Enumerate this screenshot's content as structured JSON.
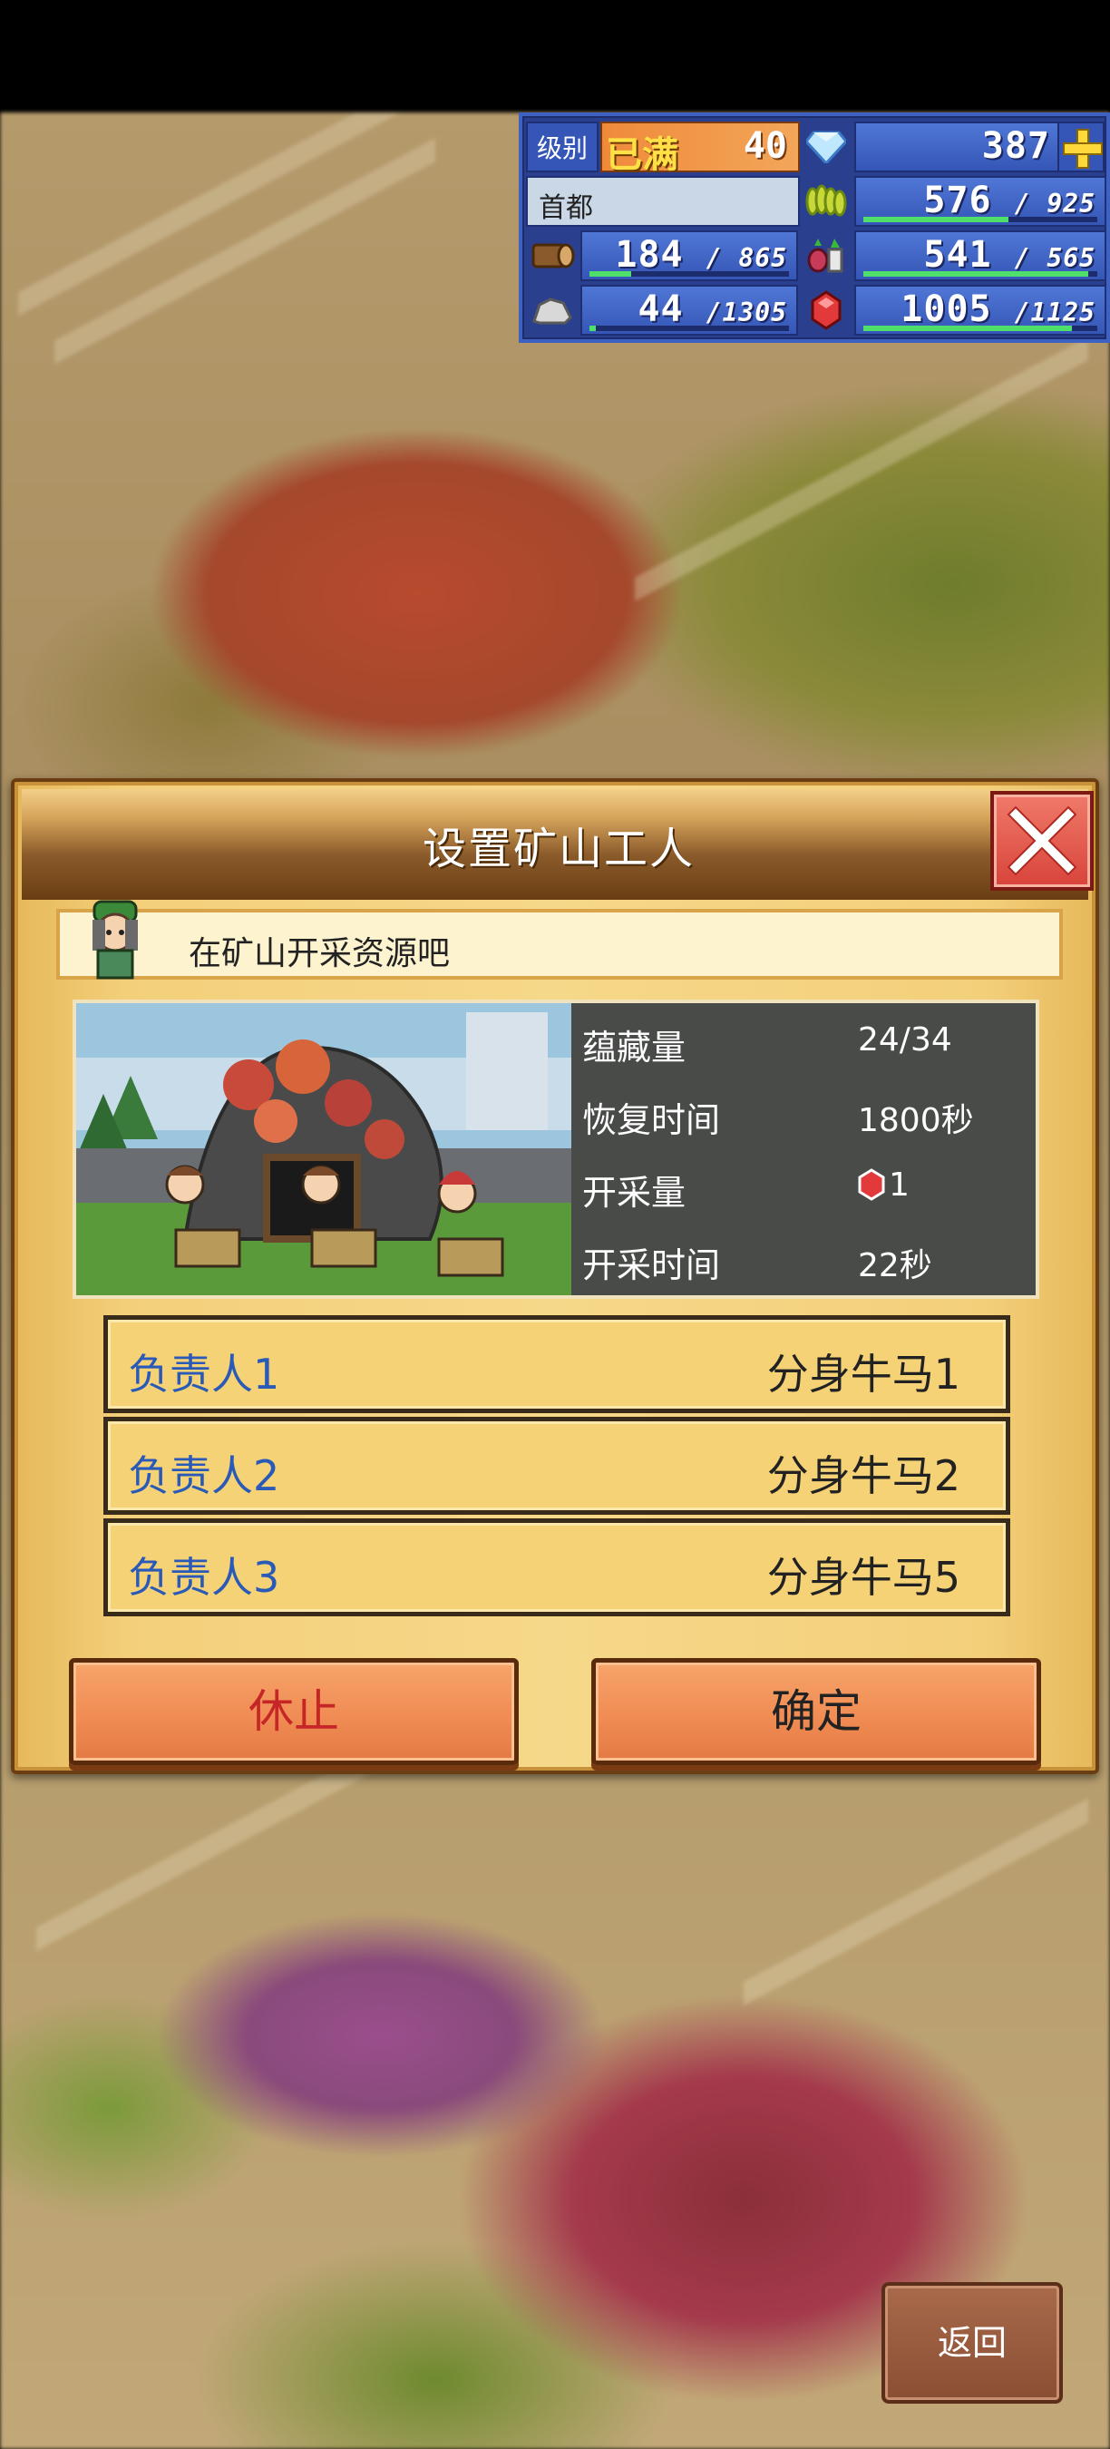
{
  "hud": {
    "level_label": "级别",
    "level_max": "已满",
    "level_value": "40",
    "gems": "387",
    "city_name": "首都",
    "resources": [
      {
        "icon": "wheat-icon",
        "value": "576",
        "max": "/ 925",
        "fill": 0.62
      },
      {
        "icon": "wood-log-icon",
        "value": "184",
        "max": "/ 865",
        "fill": 0.21
      },
      {
        "icon": "vegetables-icon",
        "value": "541",
        "max": "/ 565",
        "fill": 0.96
      },
      {
        "icon": "stone-icon",
        "value": "44",
        "max": "/1305",
        "fill": 0.03
      },
      {
        "icon": "ruby-icon",
        "value": "1005",
        "max": "/1125",
        "fill": 0.89
      }
    ]
  },
  "dialog": {
    "title": "设置矿山工人",
    "hint": "在矿山开采资源吧",
    "info": [
      {
        "label": "蕴藏量",
        "value": "24/34"
      },
      {
        "label": "恢复时间",
        "value": "1800秒"
      },
      {
        "label": "开采量",
        "value": "1"
      },
      {
        "label": "开采时间",
        "value": "22秒"
      }
    ],
    "assignments": [
      {
        "role": "负责人1",
        "worker": "分身牛马1"
      },
      {
        "role": "负责人2",
        "worker": "分身牛马2"
      },
      {
        "role": "负责人3",
        "worker": "分身牛马5"
      }
    ],
    "stop_label": "休止",
    "confirm_label": "确定"
  },
  "back_label": "返回",
  "colors": {
    "hud_blue": "#2b3f8f",
    "resource_bar": "#4ee06a",
    "dialog_gold": "#f6d88a",
    "role_text": "#2a5ab8",
    "stop_text": "#c62626",
    "button_orange": "#ef8a52"
  }
}
